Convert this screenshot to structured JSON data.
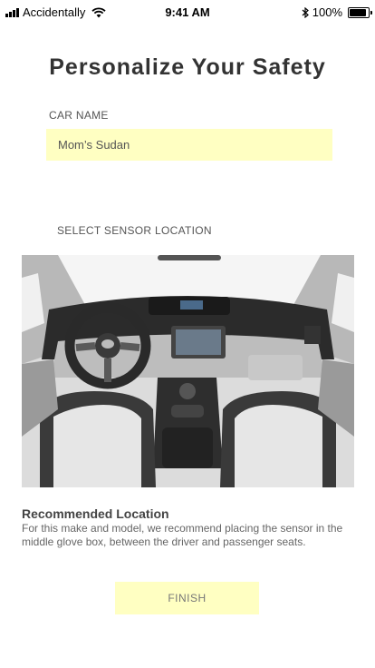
{
  "status_bar": {
    "carrier": "Accidentally",
    "time": "9:41 AM",
    "battery": "100%",
    "battery_level": 1.0,
    "icons": [
      "signal-bars-icon",
      "wifi-icon",
      "bluetooth-icon",
      "battery-icon"
    ]
  },
  "page": {
    "title": "Personalize Your Safety"
  },
  "car_name": {
    "label": "CAR NAME",
    "value": "Mom’s Sudan"
  },
  "sensor": {
    "label": "SELECT SENSOR LOCATION"
  },
  "recommendation": {
    "title": "Recommended Location",
    "body": "For this make and model, we recommend placing the sensor in the middle glove box, between the driver and passenger seats."
  },
  "actions": {
    "finish_label": "FINISH"
  },
  "colors": {
    "field_background": "#ffffc2",
    "button_background": "#ffffc2",
    "title_text": "#333333"
  }
}
